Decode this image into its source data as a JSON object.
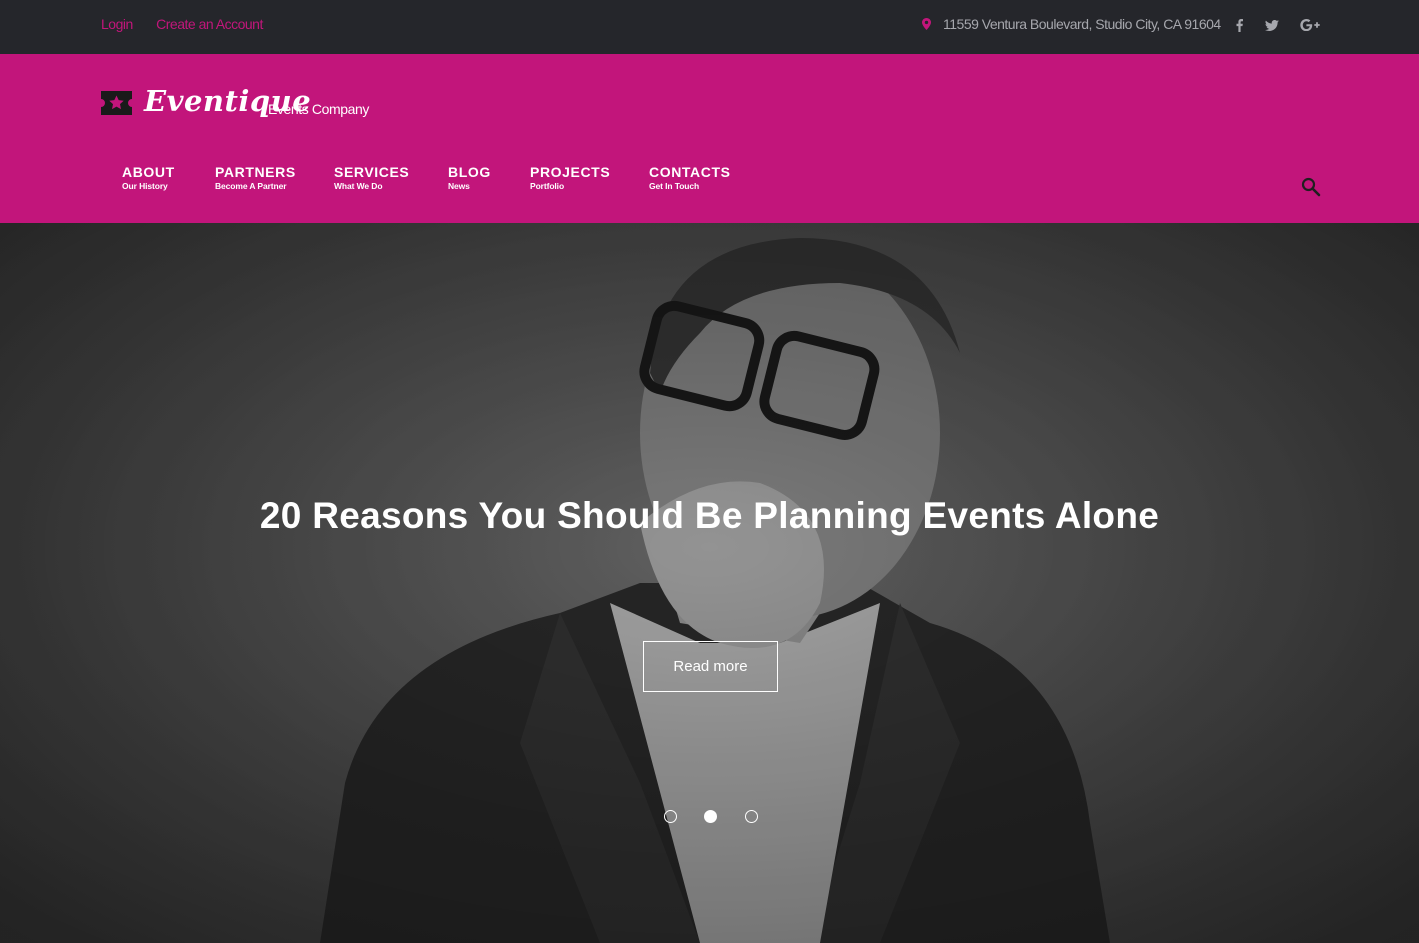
{
  "topbar": {
    "login": "Login",
    "create_account": "Create an Account",
    "address": "11559 Ventura Boulevard, Studio City, CA 91604",
    "icons": [
      "map-pin-icon",
      "facebook-icon",
      "twitter-icon",
      "google-plus-icon"
    ],
    "accent_color": "#c2167b"
  },
  "header": {
    "logo_text": "Eventique",
    "logo_sub": "Events Company",
    "background_color": "#c2157b",
    "nav": [
      {
        "label": "ABOUT",
        "sub": "Our History"
      },
      {
        "label": "PARTNERS",
        "sub": "Become A Partner"
      },
      {
        "label": "SERVICES",
        "sub": "What We Do"
      },
      {
        "label": "BLOG",
        "sub": "News"
      },
      {
        "label": "PROJECTS",
        "sub": "Portfolio"
      },
      {
        "label": "CONTACTS",
        "sub": "Get In Touch"
      }
    ]
  },
  "hero": {
    "title": "20 Reasons You Should Be Planning Events Alone",
    "button_label": "Read more",
    "slides": 3,
    "active_slide": 2
  }
}
